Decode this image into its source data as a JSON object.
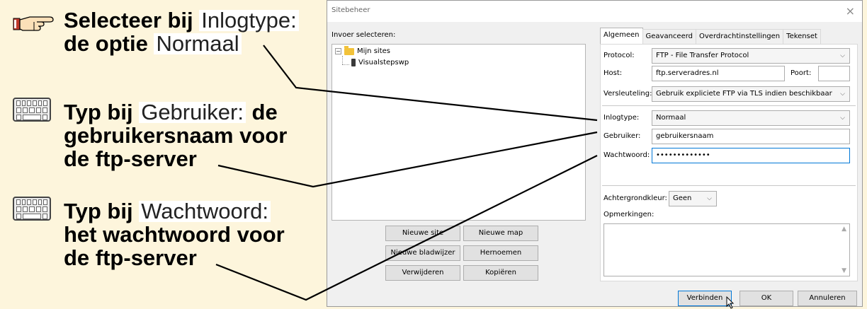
{
  "instructions": [
    {
      "before": "Selecteer bij ",
      "ui": "Inlogtype:",
      "middle": "de optie ",
      "ui2": "Normaal",
      "after": ""
    },
    {
      "before": "Typ bij ",
      "ui": "Gebruiker:",
      "after": " de gebruikersnaam voor de ftp-server"
    },
    {
      "before": "Typ bij ",
      "ui": "Wachtwoord:",
      "after": " het wachtwoord voor de ftp-server"
    }
  ],
  "dialog": {
    "title": "Sitebeheer",
    "close": "×",
    "select_entry_label": "Invoer selecteren:",
    "tree": {
      "root": "Mijn sites",
      "child": "Visualstepswp",
      "expander": "−"
    },
    "buttons": {
      "new_site": "Nieuwe site",
      "new_folder": "Nieuwe map",
      "new_bookmark": "Nieuwe bladwijzer",
      "rename": "Hernoemen",
      "delete": "Verwijderen",
      "copy": "Kopiëren",
      "connect": "Verbinden",
      "ok": "OK",
      "cancel": "Annuleren"
    },
    "tabs": [
      "Algemeen",
      "Geavanceerd",
      "Overdrachtinstellingen",
      "Tekenset"
    ],
    "form": {
      "protocol_label": "Protocol:",
      "protocol_value": "FTP - File Transfer Protocol",
      "host_label": "Host:",
      "host_value": "ftp.serveradres.nl",
      "port_label": "Poort:",
      "port_value": "",
      "encryption_label": "Versleuteling:",
      "encryption_value": "Gebruik expliciete FTP via TLS indien beschikbaar",
      "logintype_label": "Inlogtype:",
      "logintype_value": "Normaal",
      "user_label": "Gebruiker:",
      "user_value": "gebruikersnaam",
      "password_label": "Wachtwoord:",
      "password_value": "•••••••••••••",
      "bgcolor_label": "Achtergrondkleur:",
      "bgcolor_value": "Geen",
      "comments_label": "Opmerkingen:",
      "chevron": "⌵"
    }
  },
  "colors": {
    "instruction_bg": "#fdf5dc",
    "accent_focus": "#0078d7",
    "folder": "#f2c23a"
  }
}
